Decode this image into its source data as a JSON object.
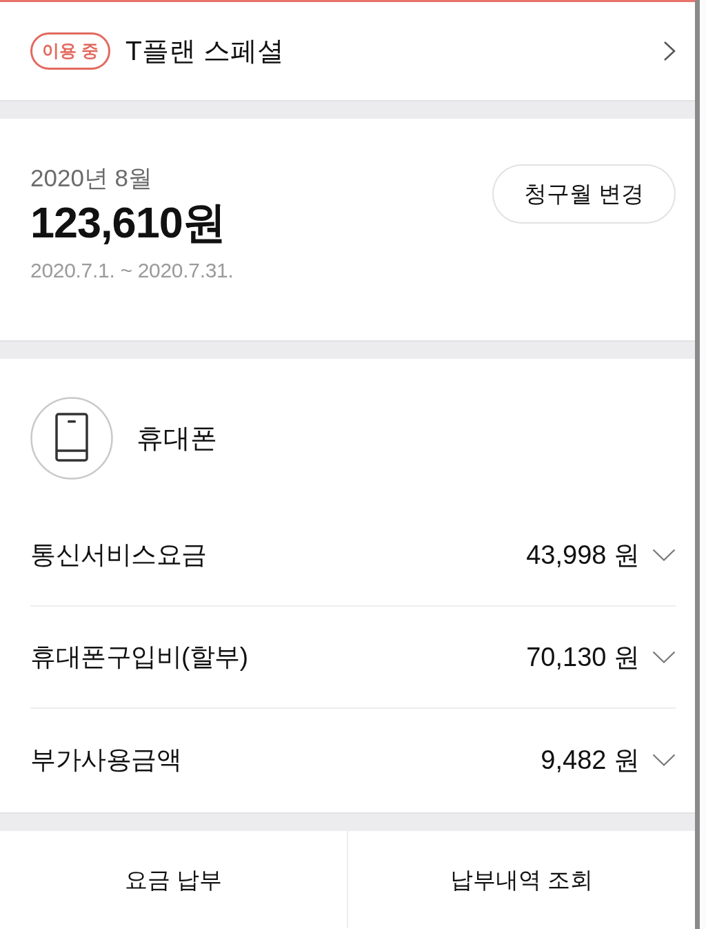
{
  "plan": {
    "badge": "이용 중",
    "title": "T플랜 스페셜"
  },
  "bill": {
    "month": "2020년 8월",
    "total": "123,610원",
    "period": "2020.7.1. ~ 2020.7.31.",
    "change_button": "청구월 변경"
  },
  "device": {
    "label": "휴대폰",
    "charges": [
      {
        "label": "통신서비스요금",
        "amount": "43,998 원",
        "expanded": false
      },
      {
        "label": "휴대폰구입비(할부)",
        "amount": "70,130 원",
        "expanded": false
      },
      {
        "label": "부가사용금액",
        "amount": "9,482 원",
        "expanded": false
      }
    ]
  },
  "actions": [
    "요금 납부",
    "납부내역 조회"
  ]
}
